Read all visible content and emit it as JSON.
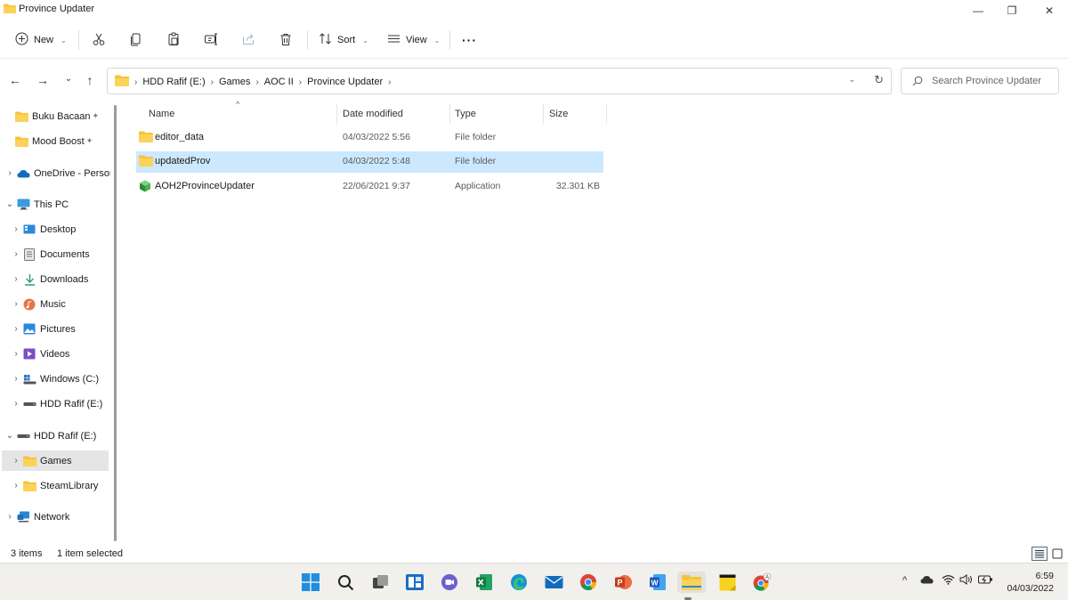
{
  "window": {
    "title": "Province Updater",
    "minimize_glyph": "—",
    "maximize_glyph": "❐",
    "close_glyph": "✕"
  },
  "commandbar": {
    "new_label": "New",
    "sort_label": "Sort",
    "view_label": "View",
    "more_glyph": "···"
  },
  "nav": {
    "back_glyph": "←",
    "forward_glyph": "→",
    "recent_glyph": "⌄",
    "up_glyph": "↑"
  },
  "address": {
    "breadcrumbs": [
      "HDD Rafif (E:)",
      "Games",
      "AOC II",
      "Province Updater"
    ],
    "separator": "›"
  },
  "search": {
    "placeholder": "Search Province Updater"
  },
  "sidebar": {
    "items": [
      {
        "label": "Buku Bacaan",
        "pinned": true
      },
      {
        "label": "Mood Boost",
        "pinned": true
      },
      {
        "label": "OneDrive - Personal"
      },
      {
        "label": "This PC"
      },
      {
        "label": "Desktop"
      },
      {
        "label": "Documents"
      },
      {
        "label": "Downloads"
      },
      {
        "label": "Music"
      },
      {
        "label": "Pictures"
      },
      {
        "label": "Videos"
      },
      {
        "label": "Windows (C:)"
      },
      {
        "label": "HDD Rafif (E:)"
      },
      {
        "label": "HDD Rafif (E:)"
      },
      {
        "label": "Games"
      },
      {
        "label": "SteamLibrary"
      },
      {
        "label": "Network"
      }
    ],
    "pin_glyph": "📌",
    "collapsed_glyph": "›",
    "expanded_glyph": "⌄"
  },
  "filelist": {
    "columns": {
      "name": "Name",
      "date": "Date modified",
      "type": "Type",
      "size": "Size"
    },
    "sort_glyph": "^",
    "rows": [
      {
        "name": "editor_data",
        "date": "04/03/2022 5:56",
        "type": "File folder",
        "size": ""
      },
      {
        "name": "updatedProv",
        "date": "04/03/2022 5:48",
        "type": "File folder",
        "size": "",
        "selected": true
      },
      {
        "name": "AOH2ProvinceUpdater",
        "date": "22/06/2021 9:37",
        "type": "Application",
        "size": "32.301 KB"
      }
    ]
  },
  "status": {
    "item_count": "3 items",
    "selection": "1 item selected"
  },
  "taskbar": {
    "time": "6:59",
    "date": "04/03/2022",
    "tray_up_glyph": "^"
  },
  "colors": {
    "folder": "#f8c33a",
    "selection": "#cce8ff",
    "accent": "#0067c0"
  }
}
